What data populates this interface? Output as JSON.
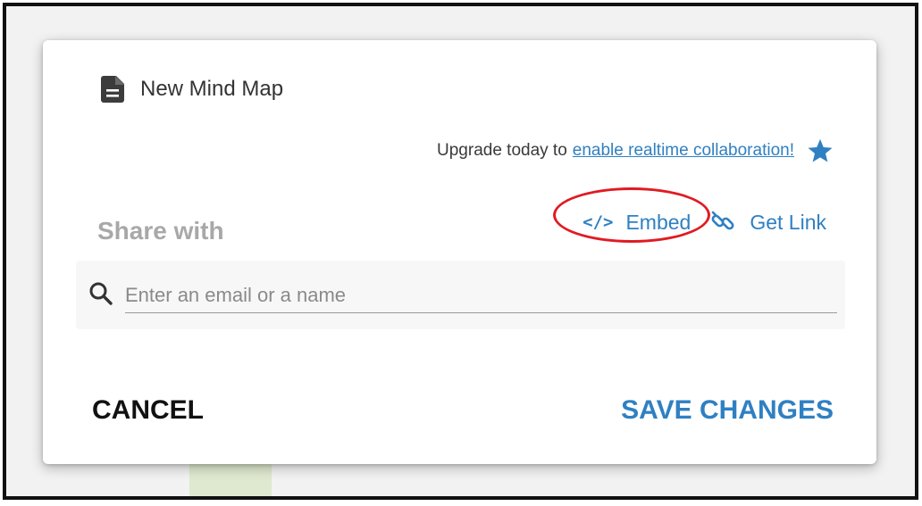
{
  "dialog": {
    "title": "New Mind Map",
    "title_icon": "document-icon",
    "upgrade": {
      "prefix": "Upgrade today to",
      "link_text": "enable realtime collaboration!",
      "icon": "star-icon"
    },
    "share": {
      "label": "Share with",
      "embed_label": "Embed",
      "embed_icon": "code-icon",
      "get_link_label": "Get Link",
      "get_link_icon": "link-icon"
    },
    "search": {
      "placeholder": "Enter an email or a name",
      "value": ""
    },
    "actions": {
      "cancel_label": "CANCEL",
      "save_label": "SAVE CHANGES"
    }
  },
  "colors": {
    "accent": "#2f80c2",
    "highlight_ring": "#e01b22",
    "muted_label": "#a8a8a8"
  }
}
